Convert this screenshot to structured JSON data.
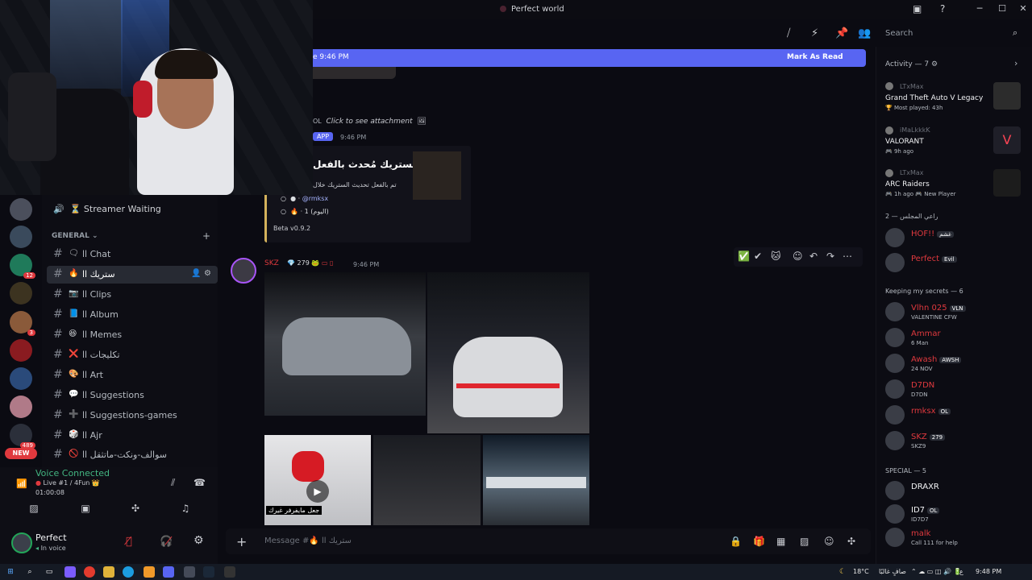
{
  "window": {
    "title": "Perfect world"
  },
  "header": {
    "search_placeholder": "Search"
  },
  "banner": {
    "left": "e 9:46 PM",
    "right": "Mark As Read"
  },
  "voice_channel": {
    "label": "⏳ Streamer Waiting"
  },
  "category": {
    "general": "GENERAL"
  },
  "channels": [
    {
      "emoji": "🗨",
      "label": "اا Chat"
    },
    {
      "emoji": "🔥",
      "label": "ستريك اا",
      "active": true
    },
    {
      "emoji": "📷",
      "label": "اا Clips"
    },
    {
      "emoji": "📘",
      "label": "اا Album"
    },
    {
      "emoji": "😆",
      "label": "اا Memes"
    },
    {
      "emoji": "❌",
      "label": "تكليجات اا"
    },
    {
      "emoji": "🎨",
      "label": "اا Art"
    },
    {
      "emoji": "💬",
      "label": "اا Suggestions"
    },
    {
      "emoji": "➕",
      "label": "اا Suggestions-games"
    },
    {
      "emoji": "🎲",
      "label": "اا Ajr"
    },
    {
      "emoji": "🚫",
      "label": "سوالف-ونكت-ماتثقل اا"
    }
  ],
  "server_rail": {
    "badges": [
      "12",
      "3",
      "489"
    ],
    "new_label": "NEW"
  },
  "voice_connected": {
    "title": "Voice Connected",
    "sub": "Live #1 / 4Fun 👑",
    "time": "01:00:08"
  },
  "user": {
    "name": "Perfect",
    "status": "In voice"
  },
  "messages": {
    "attachment_prefix": "OL",
    "attachment_text": "Click to see attachment",
    "app_tag": "APP",
    "app_time": "9:46 PM",
    "embed_title": "الستريك مُحدث بالفعل",
    "embed_desc": "تم بالفعل تحديث الستريك خلال",
    "embed_items": [
      "@rmksx",
      "1 (اليوم)"
    ],
    "embed_footer": "Beta v0.9.2",
    "post_user": "SKZ",
    "post_badge": "279",
    "post_time": "9:46 PM",
    "video_caption": "جعل مايفرفر غيرك"
  },
  "composer": {
    "placeholder": "Message #🔥 ستريك اا"
  },
  "activity": {
    "header": "Activity — 7",
    "items": [
      {
        "user": "LTxMax",
        "title": "Grand Theft Auto V Legacy",
        "sub": "🏆 Most played: 43h"
      },
      {
        "user": "iMaLkkkK",
        "title": "VALORANT",
        "sub": "🎮 9h ago"
      },
      {
        "user": "LTxMax",
        "title": "ARC Raiders",
        "sub": "🎮 1h ago  🎮 New Player"
      }
    ]
  },
  "members": {
    "section1": "راعي المجلس — 2",
    "section1_members": [
      {
        "name": "HOF!!",
        "tag": "غشم",
        "color": "#e0393e"
      },
      {
        "name": "Perfect",
        "tag": "Evil",
        "color": "#e0393e"
      }
    ],
    "section2": "Keeping my secrets — 6",
    "section2_members": [
      {
        "name": "Vlhn 025",
        "tag": "VLN",
        "sub": "VALENTINE CFW",
        "color": "#e0393e"
      },
      {
        "name": "Ammar",
        "tag": "",
        "sub": "6 Man",
        "color": "#e0393e"
      },
      {
        "name": "Awash",
        "tag": "AWSH",
        "sub": "24 NOV",
        "color": "#e0393e"
      },
      {
        "name": "D7DN",
        "tag": "",
        "sub": "D7DN",
        "color": "#e0393e"
      },
      {
        "name": "rmksx",
        "tag": "OL",
        "sub": "",
        "color": "#e0393e"
      },
      {
        "name": "SKZ",
        "tag": "279",
        "sub": "SKZ9",
        "color": "#e0393e"
      }
    ],
    "section3": "SPECIAL — 5",
    "section3_members": [
      {
        "name": "DRAXR",
        "tag": "",
        "sub": "",
        "color": "#f2f3f5"
      },
      {
        "name": "ID7",
        "tag": "OL",
        "sub": "ID7D7",
        "color": "#f2f3f5"
      },
      {
        "name": "malk",
        "tag": "",
        "sub": "Call 111 for help",
        "color": "#e0393e"
      }
    ]
  },
  "taskbar": {
    "weather": "18°C",
    "weather_text": "صافٍ غالبًا",
    "lang": "ع",
    "time": "9:48 PM"
  }
}
